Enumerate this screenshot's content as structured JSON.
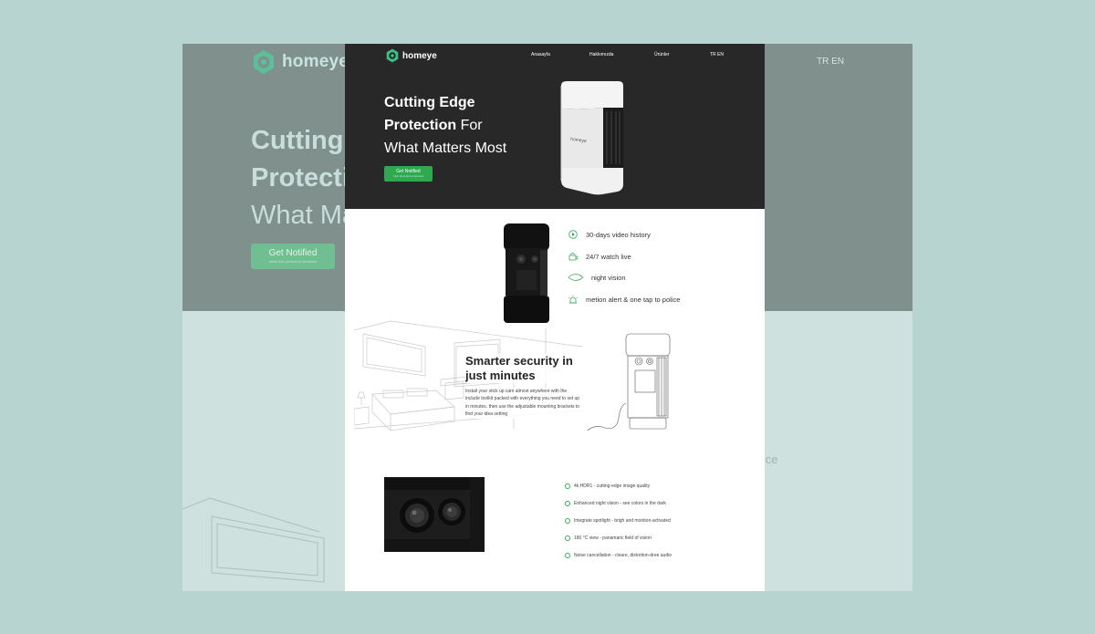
{
  "brand": {
    "name": "homeye",
    "accent": "#2fa84f",
    "hero_bg": "#282828"
  },
  "nav": {
    "items": [
      "Anasayfa",
      "Hakkımızda",
      "Ürünler"
    ],
    "lang": "TR EN"
  },
  "hero": {
    "line1": "Cutting Edge",
    "line2_bold": "Protection",
    "line2_rest": " For",
    "line3": "What Matters Most",
    "cta_label": "Get Notified",
    "cta_sub": "when this product is launched",
    "device_label": "homeye"
  },
  "features": [
    {
      "icon": "play-icon",
      "label": "30-days video history"
    },
    {
      "icon": "watch-live-icon",
      "label": "24/7 watch live"
    },
    {
      "icon": "eye-icon",
      "label": "night vision"
    },
    {
      "icon": "alarm-icon",
      "label": "metion alert & one tap to police"
    }
  ],
  "smarter": {
    "title": "Smarter security in just minutes",
    "body": "Install your stick up cam almost anywhere with the include toolkit packed with everything you need to set up in minutes. then use the adjustable mounting brackets to find your idea setting"
  },
  "specs": [
    "4k HDR1 - cutting-edge image quality",
    "Enhanced night vision - see colors in the dark",
    "Integrate spotlight - brigh and montion-activated",
    "180 °C view - panamaric field of vision",
    "Noise cancellation - cleare, distortion-dree audio"
  ],
  "background": {
    "logo": "homeye",
    "lang": "TR EN",
    "h_line1": "Cutting",
    "h_line2": "Protecti",
    "h_line3": "What Ma",
    "cta": "Get Notified",
    "cta_sub": "when this product is launched",
    "fragment": "ice"
  }
}
